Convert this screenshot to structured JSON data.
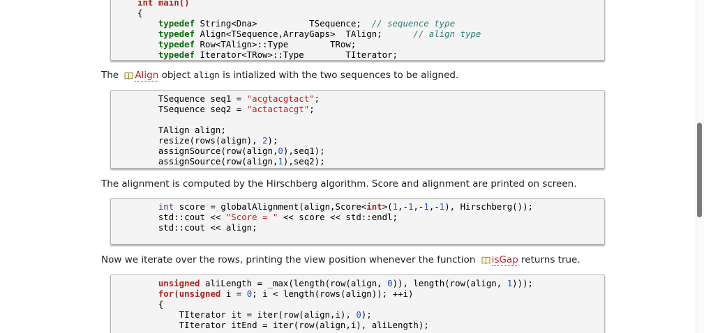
{
  "code_block_1": {
    "lines": [
      [
        {
          "t": "int main()",
          "c": "kw2"
        }
      ],
      [
        {
          "t": "{"
        }
      ],
      [
        {
          "t": "    "
        },
        {
          "t": "typedef",
          "c": "kw"
        },
        {
          "t": " String<Dna>          TSequence;  "
        },
        {
          "t": "// sequence type",
          "c": "cm"
        }
      ],
      [
        {
          "t": "    "
        },
        {
          "t": "typedef",
          "c": "kw"
        },
        {
          "t": " Align<TSequence,ArrayGaps>  TAlign;      "
        },
        {
          "t": "// align type",
          "c": "cm"
        }
      ],
      [
        {
          "t": "    "
        },
        {
          "t": "typedef",
          "c": "kw"
        },
        {
          "t": " Row<TAlign>::Type        TRow;"
        }
      ],
      [
        {
          "t": "    "
        },
        {
          "t": "typedef",
          "c": "kw"
        },
        {
          "t": " Iterator<TRow>::Type        TIterator;"
        }
      ]
    ]
  },
  "para_1": {
    "before": "The ",
    "link": "Align",
    "middle": " object ",
    "code": "align",
    "after": " is intialized with the two sequences to be aligned."
  },
  "code_block_2": {
    "lines": [
      [
        {
          "t": "    TSequence seq1 = "
        },
        {
          "t": "\"acgtacgtact\"",
          "c": "str"
        },
        {
          "t": ";"
        }
      ],
      [
        {
          "t": "    TSequence seq2 = "
        },
        {
          "t": "\"actactacgt\"",
          "c": "str"
        },
        {
          "t": ";"
        }
      ],
      [
        {
          "t": ""
        }
      ],
      [
        {
          "t": "    TAlign align;"
        }
      ],
      [
        {
          "t": "    resize(rows(align), "
        },
        {
          "t": "2",
          "c": "num"
        },
        {
          "t": ");"
        }
      ],
      [
        {
          "t": "    assignSource(row(align,"
        },
        {
          "t": "0",
          "c": "num"
        },
        {
          "t": "),seq1);"
        }
      ],
      [
        {
          "t": "    assignSource(row(align,"
        },
        {
          "t": "1",
          "c": "num"
        },
        {
          "t": "),seq2);"
        }
      ]
    ]
  },
  "para_2": {
    "text": "The alignment is computed by the Hirschberg algorithm. Score and alignment are printed on screen."
  },
  "code_block_3": {
    "lines": [
      [
        {
          "t": "    "
        },
        {
          "t": "int",
          "c": "ty"
        },
        {
          "t": " score = globalAlignment(align,Score<"
        },
        {
          "t": "int",
          "c": "kw2"
        },
        {
          "t": ">("
        },
        {
          "t": "1",
          "c": "num"
        },
        {
          "t": ",-"
        },
        {
          "t": "1",
          "c": "num"
        },
        {
          "t": ",-"
        },
        {
          "t": "1",
          "c": "num"
        },
        {
          "t": ",-"
        },
        {
          "t": "1",
          "c": "num"
        },
        {
          "t": "), Hirschberg());"
        }
      ],
      [
        {
          "t": "    std::cout << "
        },
        {
          "t": "\"Score = \"",
          "c": "str"
        },
        {
          "t": " << score << std::endl;"
        }
      ],
      [
        {
          "t": "    std::cout << align;"
        }
      ]
    ]
  },
  "para_3": {
    "before": "Now we iterate over the rows, printing the view position whenever the function ",
    "link": "isGap",
    "after": " returns true."
  },
  "code_block_4": {
    "lines": [
      [
        {
          "t": "    "
        },
        {
          "t": "unsigned",
          "c": "kw2"
        },
        {
          "t": " aliLength = _max(length(row(align, "
        },
        {
          "t": "0",
          "c": "num"
        },
        {
          "t": ")), length(row(align, "
        },
        {
          "t": "1",
          "c": "num"
        },
        {
          "t": ")));"
        }
      ],
      [
        {
          "t": "    "
        },
        {
          "t": "for",
          "c": "kw2"
        },
        {
          "t": "("
        },
        {
          "t": "unsigned",
          "c": "kw2"
        },
        {
          "t": " i = "
        },
        {
          "t": "0",
          "c": "num"
        },
        {
          "t": "; i < length(rows(align)); ++i)"
        }
      ],
      [
        {
          "t": "    {"
        }
      ],
      [
        {
          "t": "        TIterator it = iter(row(align,i), "
        },
        {
          "t": "0",
          "c": "num"
        },
        {
          "t": ");"
        }
      ],
      [
        {
          "t": "        TIterator itEnd = iter(row(align,i), aliLength);"
        }
      ]
    ]
  },
  "colors": {
    "keyword": "#0a6b0a",
    "keyword_alt": "#b0201f",
    "type": "#6a2fa0",
    "string": "#c0201f",
    "number": "#1a56c4",
    "comment": "#2e7f76",
    "link": "#c21d2a",
    "code_bg": "#f4f4f4"
  },
  "icons": {
    "doc_link": "open-book-icon"
  }
}
